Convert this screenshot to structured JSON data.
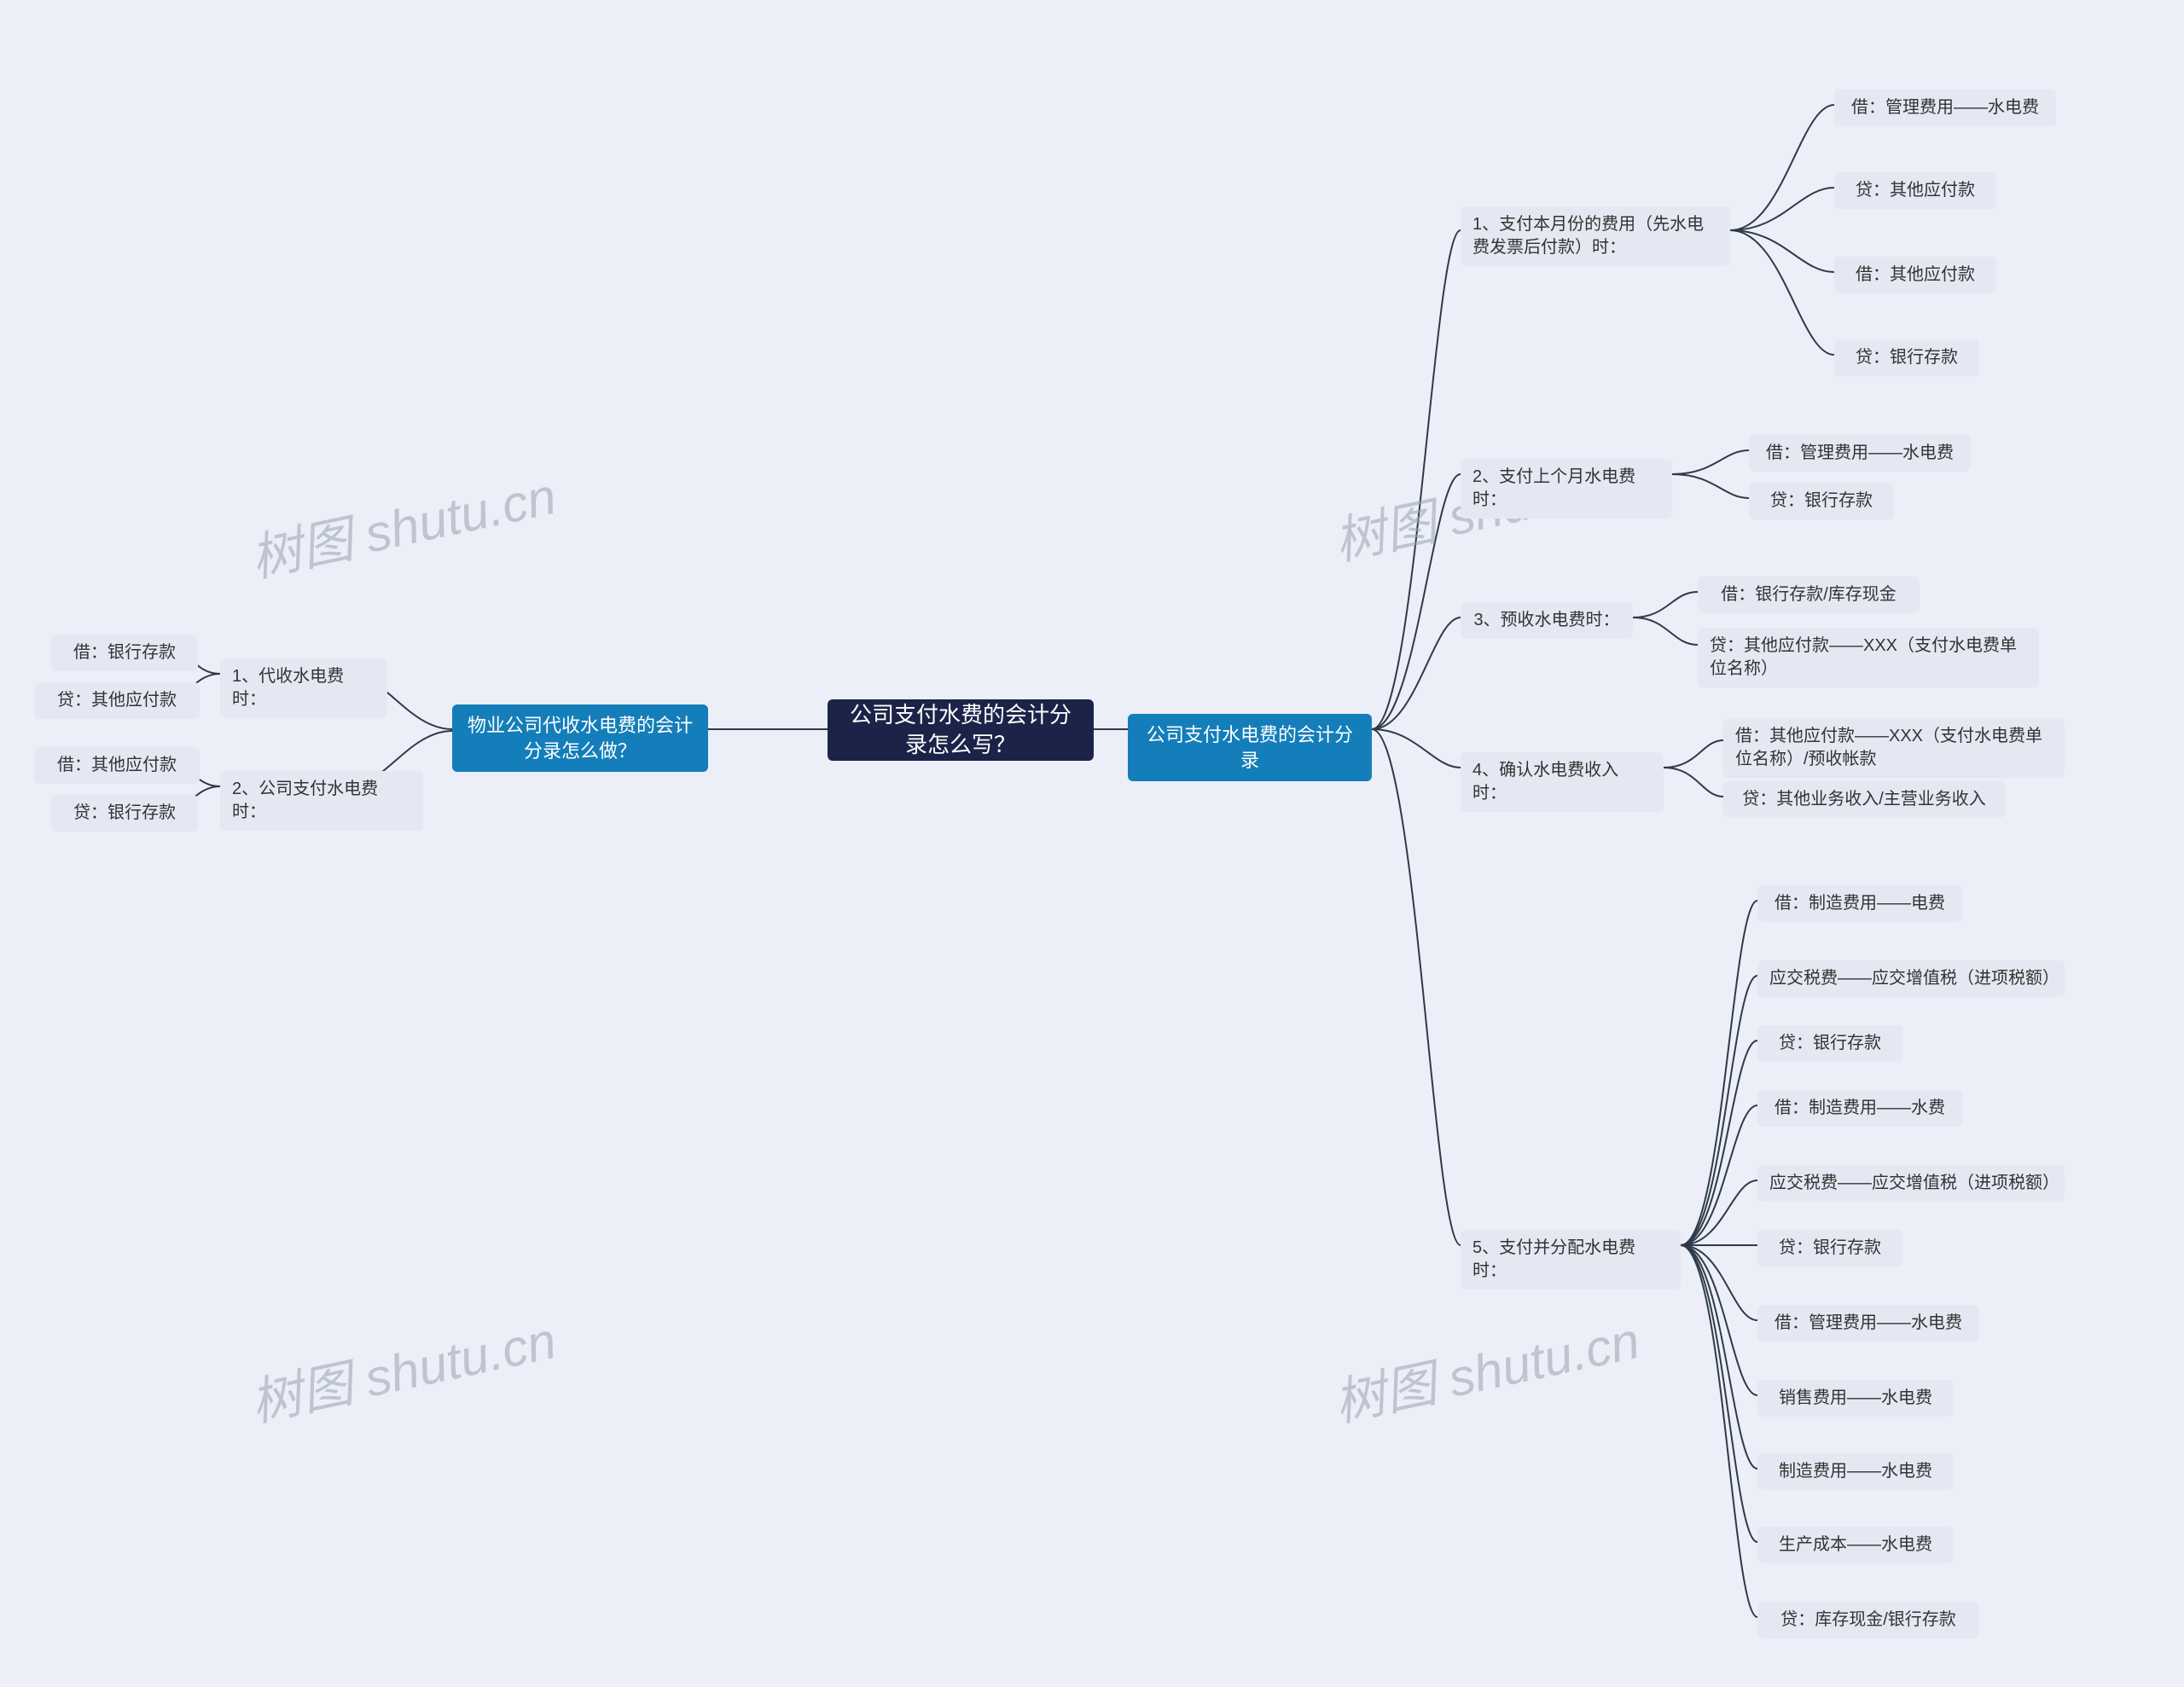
{
  "watermark_text": "树图 shutu.cn",
  "root": {
    "label": "公司支付水费的会计分录怎么写？"
  },
  "right": {
    "l1_label": "公司支付水电费的会计分录",
    "items": [
      {
        "label": "1、支付本月份的费用（先水电费发票后付款）时：",
        "leaves": [
          "借：管理费用——水电费",
          "贷：其他应付款",
          "借：其他应付款",
          "贷：银行存款"
        ]
      },
      {
        "label": "2、支付上个月水电费时：",
        "leaves": [
          "借：管理费用——水电费",
          "贷：银行存款"
        ]
      },
      {
        "label": "3、预收水电费时：",
        "leaves": [
          "借：银行存款/库存现金",
          "贷：其他应付款——XXX（支付水电费单位名称）"
        ]
      },
      {
        "label": "4、确认水电费收入时：",
        "leaves": [
          "借：其他应付款——XXX（支付水电费单位名称）/预收帐款",
          "贷：其他业务收入/主营业务收入"
        ]
      },
      {
        "label": "5、支付并分配水电费时：",
        "leaves": [
          "借：制造费用——电费",
          "应交税费——应交增值税（进项税额）",
          "贷：银行存款",
          "借：制造费用——水费",
          "应交税费——应交增值税（进项税额）",
          "贷：银行存款",
          "借：管理费用——水电费",
          "销售费用——水电费",
          "制造费用——水电费",
          "生产成本——水电费",
          "贷：库存现金/银行存款"
        ]
      }
    ]
  },
  "left": {
    "l1_label": "物业公司代收水电费的会计分录怎么做？",
    "items": [
      {
        "label": "1、代收水电费时：",
        "leaves": [
          "借：银行存款",
          "贷：其他应付款"
        ]
      },
      {
        "label": "2、公司支付水电费时：",
        "leaves": [
          "借：其他应付款",
          "贷：银行存款"
        ]
      }
    ]
  }
}
